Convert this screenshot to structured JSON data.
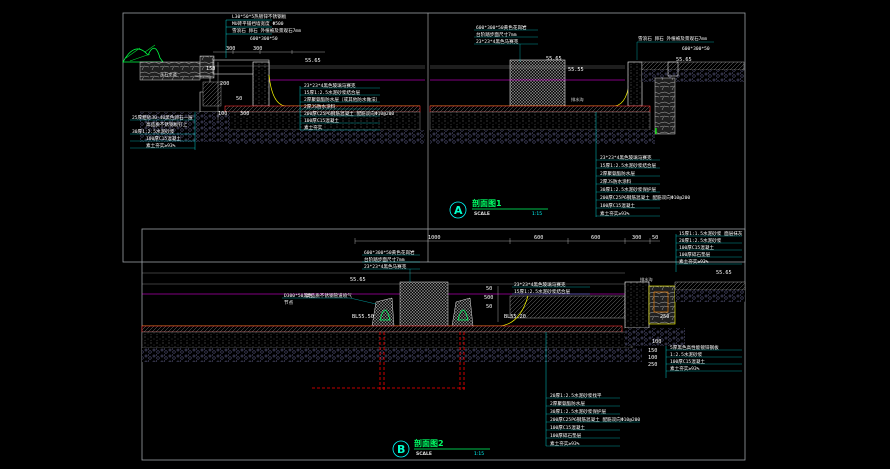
{
  "colors": {
    "background": "#000000",
    "frame": "#9aa0a6",
    "leader": "#00ffff",
    "water": "#ff00ff",
    "slab": "#ff3333",
    "gravel": "#8080a0",
    "edge": "#ffff00",
    "title": "#00ff66"
  },
  "section_a": {
    "mark": "A",
    "title": "剖面图1",
    "scale_word": "SCALE",
    "ratio": "1:15",
    "dims_top": [
      "300",
      "300",
      "55.65"
    ],
    "dims_side": [
      "150",
      "200",
      "50",
      "100",
      "300"
    ],
    "ground_label": "永石步道",
    "left_labels": [
      "L30*50*5热镀锌不锈钢板",
      "MU砖平铺挡墙宽度 Φ500",
      "雪浪石  卵石  外植被及景观石7mm",
      "600*300*50"
    ],
    "level_labels": [
      "55.65",
      "55.55"
    ],
    "water_notes": [
      "23*23*4黑色玻璃马赛克",
      "15厚1:2.5水泥砂浆结合层",
      "2厚聚氨酯防水层（或其他防水做法）",
      "2厚JS防水涂料",
      "200厚C25P6钢筋混凝土  配筋双向Φ10@200",
      "100厚C15混凝土",
      "素土夯实"
    ],
    "base_notes": [
      "25厚粗砂30-40黑色卵石一层",
      "高品质不锈钢板钉上",
      "30厚1:2.5水泥砂浆",
      "100厚C15混凝土",
      "素土夯实≥93%"
    ],
    "center_labels": [
      "600*300*50黄色花岗岩",
      "台阶踏步面尺寸7mm",
      "23*23*4黑色马赛克"
    ],
    "right_labels": [
      "雪浪石  卵石  外植被及景观石7mm",
      "600*300*50"
    ],
    "right_notes": [
      "23*23*4黑色玻璃马赛克",
      "15厚1:2.5水泥砂浆结合层",
      "2厚聚氨酯防水层",
      "2厚JS防水涂料",
      "30厚1:2.5水泥砂浆保护层",
      "200厚C25P6钢筋混凝土  配筋双向Φ10@200",
      "100厚C15混凝土",
      "素土夯实≥93%"
    ],
    "small_labels": [
      "BL55.55",
      "排水沟",
      "55.65"
    ]
  },
  "section_b": {
    "mark": "B",
    "title": "剖面图2",
    "scale_word": "SCALE",
    "ratio": "1:15",
    "dims_top": [
      "1000",
      "600",
      "600",
      "300",
      "50"
    ],
    "top_labels": [
      "600*300*50黄色花岗岩",
      "台阶踏步面尺寸7mm",
      "23*23*4黑色马赛克"
    ],
    "mid_labels": [
      "23*23*4黑色玻璃马赛克",
      "15厚1:2.5水泥砂浆结合层"
    ],
    "pipe_labels": [
      "D300*50黑色",
      "高品质不锈钢管道喷气",
      "节点"
    ],
    "levels": [
      "55.65",
      "BL55.50",
      "BL55.20"
    ],
    "dims_right": [
      "50",
      "500",
      "50",
      "250",
      "100"
    ],
    "right_top_notes": [
      "15厚1:1.5水泥砂浆  面层抹灰",
      "20厚1:2.5水泥砂浆",
      "100厚C15混凝土",
      "100厚碎石垫层",
      "素土夯实≥93%"
    ],
    "right_mid_notes": [
      "排水沟",
      "55.65"
    ],
    "right_low_notes": [
      "5厚黑色高性能镀锌钢板",
      "1:2.5水泥砂浆",
      "100厚C15混凝土",
      "素土夯实≥93%"
    ],
    "bottom_notes": [
      "20厚1:2.5水泥砂浆找平",
      "2厚聚氨酯防水层",
      "30厚1:2.5水泥砂浆保护层",
      "200厚C25P6钢筋混凝土  配筋双向Φ10@200",
      "100厚C15混凝土",
      "100厚碎石垫层",
      "素土夯实≥93%"
    ],
    "side_dims": [
      "150",
      "100",
      "250"
    ]
  }
}
